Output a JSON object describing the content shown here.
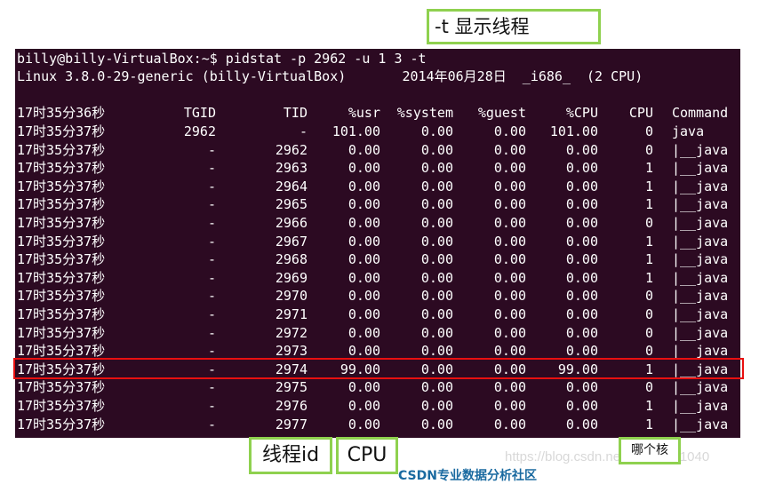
{
  "annotations": {
    "top": "-t 显示线程",
    "thread_id": "线程id",
    "cpu": "CPU",
    "which_core": "哪个核"
  },
  "watermark": "https://blog.csdn.net/qq_43191040",
  "cut_text": "CSDN专业数据分析社区",
  "terminal": {
    "prompt_line": "billy@billy-VirtualBox:~$ pidstat -p 2962 -u 1 3 -t",
    "info_line": "Linux 3.8.0-29-generic (billy-VirtualBox)       2014年06月28日  _i686_  (2 CPU)",
    "header": {
      "time": "17时35分36秒",
      "tgid": "TGID",
      "tid": "TID",
      "usr": "%usr",
      "system": "%system",
      "guest": "%guest",
      "pcpu": "%CPU",
      "cpu": "CPU",
      "command": "Command"
    },
    "rows": [
      {
        "time": "17时35分37秒",
        "tgid": "2962",
        "tid": "-",
        "usr": "101.00",
        "system": "0.00",
        "guest": "0.00",
        "pcpu": "101.00",
        "cpu": "0",
        "command": "java"
      },
      {
        "time": "17时35分37秒",
        "tgid": "-",
        "tid": "2962",
        "usr": "0.00",
        "system": "0.00",
        "guest": "0.00",
        "pcpu": "0.00",
        "cpu": "0",
        "command": "|__java"
      },
      {
        "time": "17时35分37秒",
        "tgid": "-",
        "tid": "2963",
        "usr": "0.00",
        "system": "0.00",
        "guest": "0.00",
        "pcpu": "0.00",
        "cpu": "1",
        "command": "|__java"
      },
      {
        "time": "17时35分37秒",
        "tgid": "-",
        "tid": "2964",
        "usr": "0.00",
        "system": "0.00",
        "guest": "0.00",
        "pcpu": "0.00",
        "cpu": "1",
        "command": "|__java"
      },
      {
        "time": "17时35分37秒",
        "tgid": "-",
        "tid": "2965",
        "usr": "0.00",
        "system": "0.00",
        "guest": "0.00",
        "pcpu": "0.00",
        "cpu": "1",
        "command": "|__java"
      },
      {
        "time": "17时35分37秒",
        "tgid": "-",
        "tid": "2966",
        "usr": "0.00",
        "system": "0.00",
        "guest": "0.00",
        "pcpu": "0.00",
        "cpu": "0",
        "command": "|__java"
      },
      {
        "time": "17时35分37秒",
        "tgid": "-",
        "tid": "2967",
        "usr": "0.00",
        "system": "0.00",
        "guest": "0.00",
        "pcpu": "0.00",
        "cpu": "1",
        "command": "|__java"
      },
      {
        "time": "17时35分37秒",
        "tgid": "-",
        "tid": "2968",
        "usr": "0.00",
        "system": "0.00",
        "guest": "0.00",
        "pcpu": "0.00",
        "cpu": "1",
        "command": "|__java"
      },
      {
        "time": "17时35分37秒",
        "tgid": "-",
        "tid": "2969",
        "usr": "0.00",
        "system": "0.00",
        "guest": "0.00",
        "pcpu": "0.00",
        "cpu": "1",
        "command": "|__java"
      },
      {
        "time": "17时35分37秒",
        "tgid": "-",
        "tid": "2970",
        "usr": "0.00",
        "system": "0.00",
        "guest": "0.00",
        "pcpu": "0.00",
        "cpu": "0",
        "command": "|__java"
      },
      {
        "time": "17时35分37秒",
        "tgid": "-",
        "tid": "2971",
        "usr": "0.00",
        "system": "0.00",
        "guest": "0.00",
        "pcpu": "0.00",
        "cpu": "0",
        "command": "|__java"
      },
      {
        "time": "17时35分37秒",
        "tgid": "-",
        "tid": "2972",
        "usr": "0.00",
        "system": "0.00",
        "guest": "0.00",
        "pcpu": "0.00",
        "cpu": "0",
        "command": "|__java"
      },
      {
        "time": "17时35分37秒",
        "tgid": "-",
        "tid": "2973",
        "usr": "0.00",
        "system": "0.00",
        "guest": "0.00",
        "pcpu": "0.00",
        "cpu": "0",
        "command": "|__java"
      },
      {
        "time": "17时35分37秒",
        "tgid": "-",
        "tid": "2974",
        "usr": "99.00",
        "system": "0.00",
        "guest": "0.00",
        "pcpu": "99.00",
        "cpu": "1",
        "command": "|__java"
      },
      {
        "time": "17时35分37秒",
        "tgid": "-",
        "tid": "2975",
        "usr": "0.00",
        "system": "0.00",
        "guest": "0.00",
        "pcpu": "0.00",
        "cpu": "0",
        "command": "|__java"
      },
      {
        "time": "17时35分37秒",
        "tgid": "-",
        "tid": "2976",
        "usr": "0.00",
        "system": "0.00",
        "guest": "0.00",
        "pcpu": "0.00",
        "cpu": "1",
        "command": "|__java"
      },
      {
        "time": "17时35分37秒",
        "tgid": "-",
        "tid": "2977",
        "usr": "0.00",
        "system": "0.00",
        "guest": "0.00",
        "pcpu": "0.00",
        "cpu": "1",
        "command": "|__java"
      }
    ],
    "highlight_color": "#e81010"
  }
}
